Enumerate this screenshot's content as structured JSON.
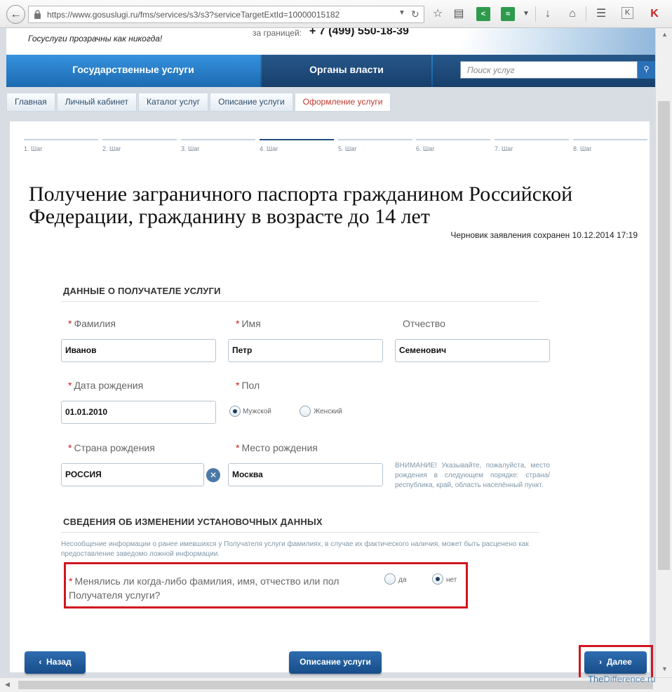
{
  "browser": {
    "url": "https://www.gosuslugi.ru/fms/services/s3/s3?serviceTargetExtId=10000015182"
  },
  "header": {
    "slogan": "Госуслуги прозрачны как никогда!",
    "abroad_label": "за границей:",
    "phone": "+ 7 (499) 550-18-39"
  },
  "nav": {
    "gov_services": "Государственные услуги",
    "authorities": "Органы власти",
    "search_placeholder": "Поиск услуг"
  },
  "breadcrumbs": [
    "Главная",
    "Личный кабинет",
    "Каталог услуг",
    "Описание услуги",
    "Оформление услуги"
  ],
  "steps": [
    "1. Шаг",
    "2. Шаг",
    "3. Шаг",
    "4. Шаг",
    "5. Шаг",
    "6. Шаг",
    "7. Шаг",
    "8. Шаг"
  ],
  "active_step": 4,
  "title": "Получение заграничного паспорта гражданином Российской Федерации, гражданину в возрасте до 14 лет",
  "draft_saved": "Черновик заявления сохранен 10.12.2014 17:19",
  "recipient": {
    "heading": "ДАННЫЕ О ПОЛУЧАТЕЛЕ УСЛУГИ",
    "surname_label": "Фамилия",
    "surname": "Иванов",
    "name_label": "Имя",
    "name": "Петр",
    "patronymic_label": "Отчество",
    "patronymic": "Семенович",
    "birthdate_label": "Дата рождения",
    "birthdate": "01.01.2010",
    "sex_label": "Пол",
    "sex_male": "Мужской",
    "sex_female": "Женский",
    "country_label": "Страна рождения",
    "country": "РОССИЯ",
    "place_label": "Место рождения",
    "place": "Москва",
    "place_note": "ВНИМАНИЕ! Указывайте, пожалуйста, место рождения в следующем порядке: страна/республика, край, область населённый пункт."
  },
  "changes": {
    "heading": "СВЕДЕНИЯ ОБ ИЗМЕНЕНИИ УСТАНОВОЧНЫХ ДАННЫХ",
    "disclaimer": "Несообщение информации о ранее имевшихся у Получателя услуги фамилиях, в случае их фактического наличия, может быть расценено как предоставление заведомо ложной информации.",
    "question": "Менялись ли когда-либо фамилия, имя, отчество или пол Получателя услуги?",
    "yes": "да",
    "no": "нет"
  },
  "buttons": {
    "back": "Назад",
    "description": "Описание услуги",
    "next": "Далее"
  },
  "watermark": {
    "prefix": "The",
    "rest": "Difference.ru"
  },
  "colors": {
    "nav_blue": "#1c6bb2",
    "button_blue": "#174d89",
    "highlight_red": "#d0171f",
    "active_crumb": "#c2382e"
  }
}
